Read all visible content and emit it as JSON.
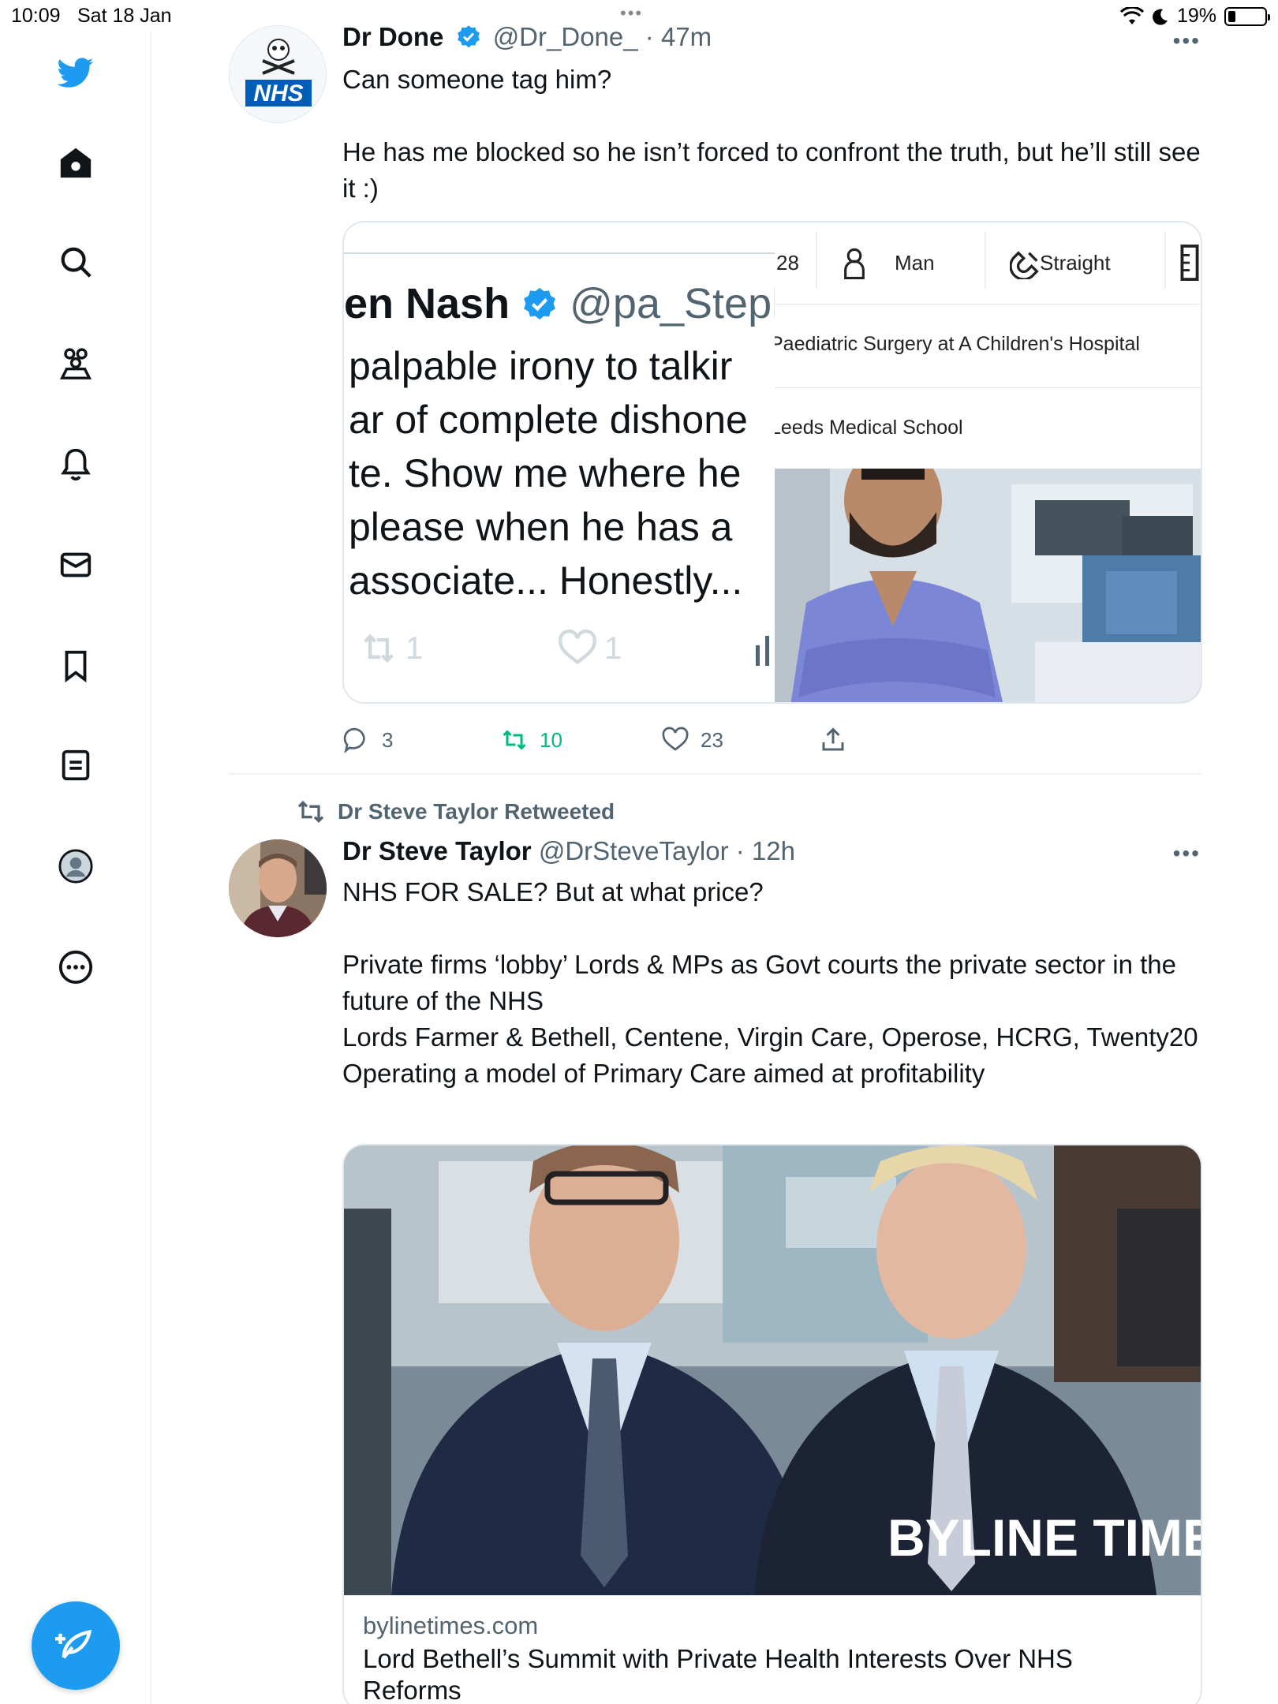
{
  "status_bar": {
    "time": "10:09",
    "date": "Sat 18 Jan",
    "battery": "19%"
  },
  "sidebar": {
    "items": [
      "home-icon",
      "search-icon",
      "communities-icon",
      "notifications-icon",
      "messages-icon",
      "bookmarks-icon",
      "lists-icon",
      "profile-icon",
      "more-icon"
    ]
  },
  "colors": {
    "accent": "#1d9bf0",
    "retweet_green": "#00ba7c",
    "secondary_text": "#536471"
  },
  "tweet1": {
    "name": "Dr Done",
    "handle": "@Dr_Done_",
    "time": "47m",
    "avatar_text": "NHS",
    "text_line1": "Can someone tag him?",
    "text_line2": "He has me blocked so he isn’t forced to confront the truth, but he’ll still see it :)",
    "embedded": {
      "left_name": "en Nash",
      "left_handle": "@pa_Steph",
      "left_lines": [
        "palpable irony to talkir",
        "ar of complete dishone",
        "te. Show me where he",
        "please when he has a",
        "associate... Honestly..."
      ],
      "left_retweets": "1",
      "left_likes": "1",
      "right_age": "28",
      "right_gender": "Man",
      "right_orientation": "Straight",
      "right_job": "Paediatric Surgery at A Children's Hospital",
      "right_school": "Leeds Medical School"
    },
    "replies": "3",
    "retweets": "10",
    "likes": "23"
  },
  "tweet2": {
    "retweeted_by": "Dr Steve Taylor Retweeted",
    "name": "Dr Steve Taylor",
    "handle": "@DrSteveTaylor",
    "time": "12h",
    "line1": "NHS FOR SALE? But at what price?",
    "line2": "Private firms ‘lobby’ Lords & MPs as Govt courts the private sector in the future of the NHS",
    "line3": "Lords Farmer & Bethell, Centene, Virgin Care, Operose, HCRG, Twenty20",
    "line4": "Operating a model of Primary Care aimed at profitability",
    "card": {
      "watermark": "BYLINE TIMES",
      "domain": "bylinetimes.com",
      "title": "Lord Bethell’s Summit with Private Health Interests Over NHS Reforms"
    }
  }
}
